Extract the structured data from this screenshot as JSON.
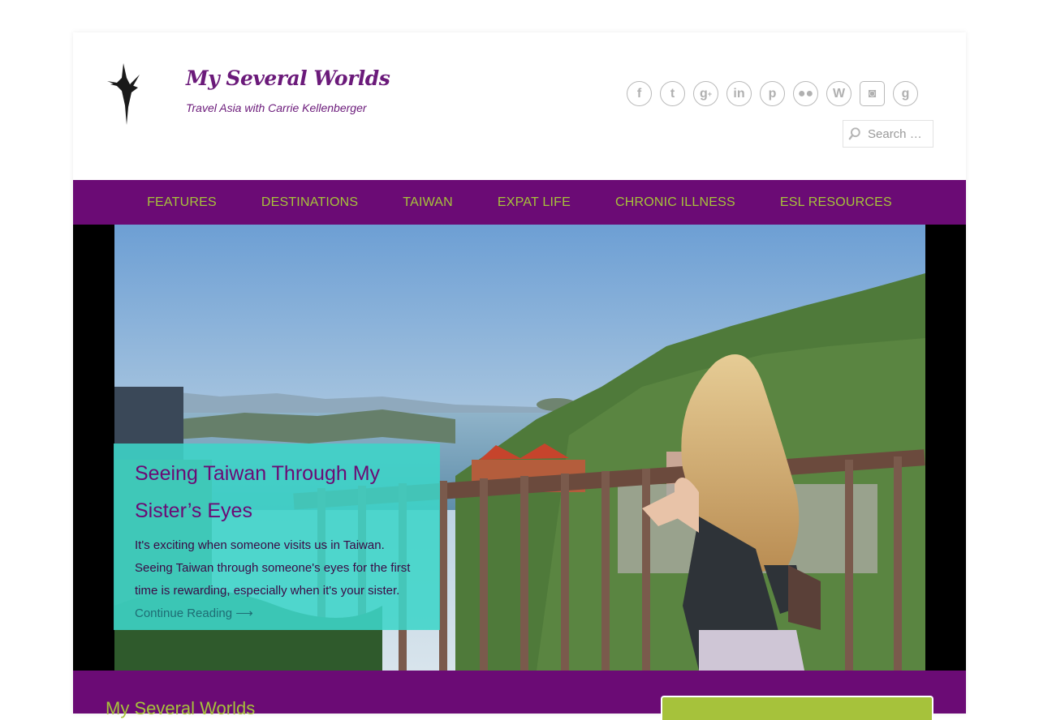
{
  "header": {
    "site_title": "My Several Worlds",
    "tagline": "Travel Asia with Carrie Kellenberger",
    "social_icons": [
      "facebook-icon",
      "twitter-icon",
      "google-plus-icon",
      "linkedin-icon",
      "pinterest-icon",
      "flickr-icon",
      "wordpress-icon",
      "instagram-icon",
      "goodreads-icon"
    ],
    "search": {
      "placeholder": "Search …"
    }
  },
  "nav": {
    "items": [
      "FEATURES",
      "DESTINATIONS",
      "TAIWAN",
      "EXPAT LIFE",
      "CHRONIC ILLNESS",
      "ESL RESOURCES"
    ]
  },
  "hero": {
    "title": "Seeing Taiwan Through My Sister’s Eyes",
    "excerpt": "It's exciting when someone visits us in Taiwan. Seeing Taiwan through someone's eyes for the first time is rewarding, especially when it's your sister.",
    "continue_label": "Continue Reading ⟶"
  },
  "footer": {
    "title": "My Several Worlds"
  },
  "colors": {
    "brand_purple": "#6b0b75",
    "nav_text_green": "#a6c23b",
    "feature_box_teal": "#3ed5c8"
  }
}
